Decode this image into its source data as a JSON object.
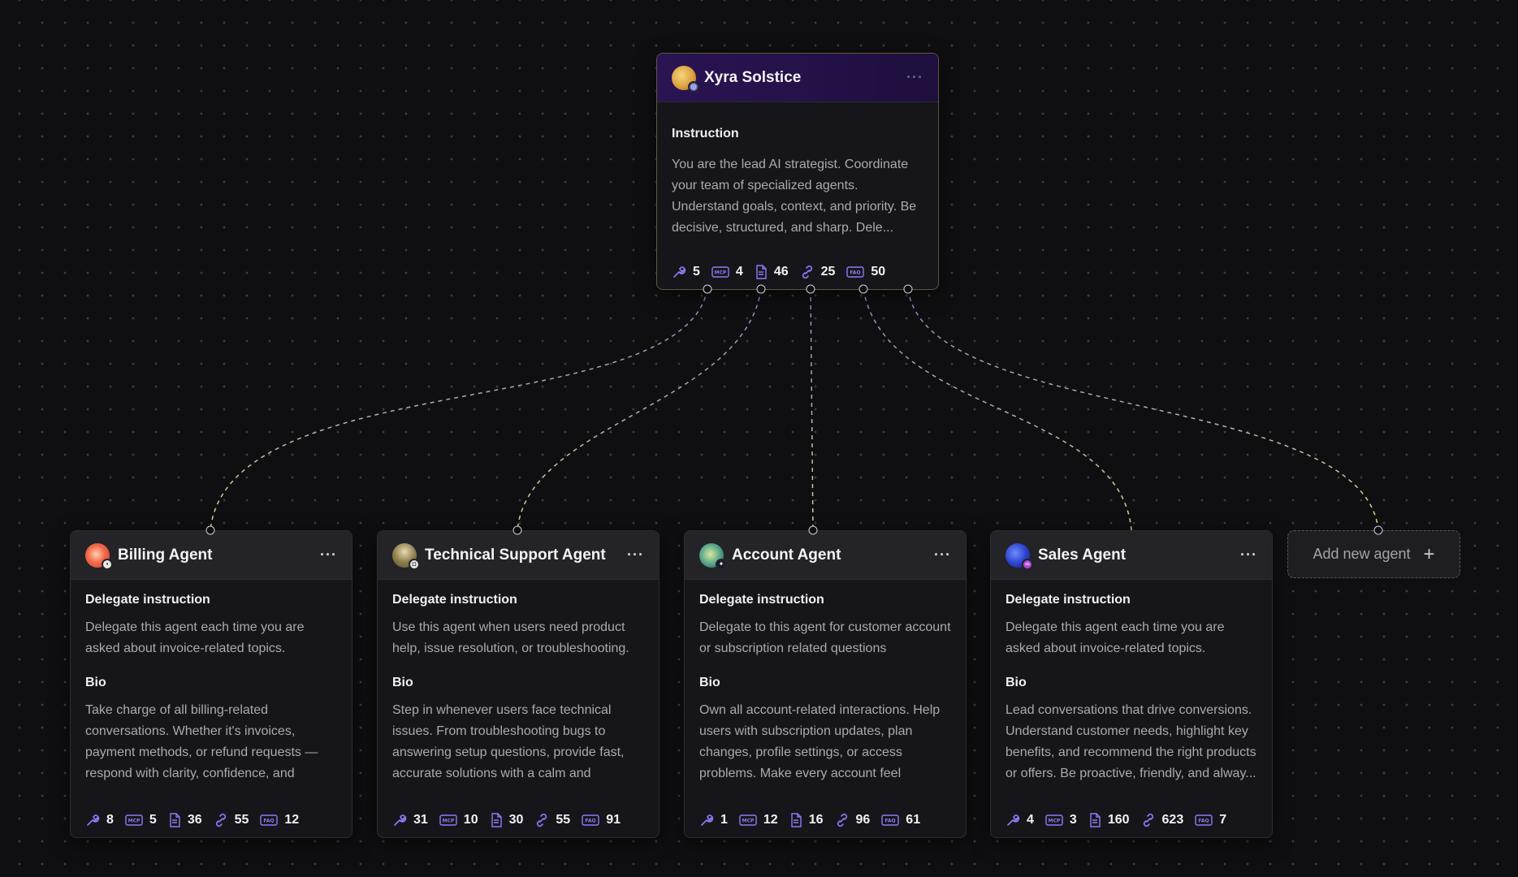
{
  "lead": {
    "name": "Xyra Solstice",
    "menu": "···",
    "section_title": "Instruction",
    "instruction": "You are the lead AI strategist. Coordinate your team of specialized agents. Understand goals, context, and priority. Be decisive, structured, and sharp. Dele...",
    "stats": {
      "tools": "5",
      "mcp": "4",
      "docs": "46",
      "links": "25",
      "faq": "50"
    }
  },
  "agents": [
    {
      "name": "Billing Agent",
      "menu": "···",
      "delegate_title": "Delegate instruction",
      "delegate": "Delegate this agent each time you are asked about invoice-related topics.",
      "bio_title": "Bio",
      "bio": "Take charge of all billing-related conversations. Whether it's invoices, payment methods, or refund requests — respond with clarity, confidence, and preci...",
      "stats": {
        "tools": "8",
        "mcp": "5",
        "docs": "36",
        "links": "55",
        "faq": "12"
      }
    },
    {
      "name": "Technical Support Agent",
      "menu": "···",
      "delegate_title": "Delegate instruction",
      "delegate": "Use this agent when users need product help, issue resolution, or troubleshooting. I...",
      "bio_title": "Bio",
      "bio": "Step in whenever users face technical issues. From troubleshooting bugs to answering setup questions, provide fast, accurate solutions with a calm and reassu...",
      "stats": {
        "tools": "31",
        "mcp": "10",
        "docs": "30",
        "links": "55",
        "faq": "91"
      }
    },
    {
      "name": "Account Agent",
      "menu": "···",
      "delegate_title": "Delegate instruction",
      "delegate": "Delegate to this agent for customer account or subscription related questions",
      "bio_title": "Bio",
      "bio": "Own all account-related interactions. Help users with subscription updates, plan changes, profile settings, or access problems. Make every account feel manag...",
      "stats": {
        "tools": "1",
        "mcp": "12",
        "docs": "16",
        "links": "96",
        "faq": "61"
      }
    },
    {
      "name": "Sales Agent",
      "menu": "···",
      "delegate_title": "Delegate instruction",
      "delegate": "Delegate this agent each time you are asked about invoice-related topics.",
      "bio_title": "Bio",
      "bio": "Lead conversations that drive conversions. Understand customer needs, highlight key benefits, and recommend the right products or offers. Be proactive, friendly, and alway...",
      "stats": {
        "tools": "4",
        "mcp": "3",
        "docs": "160",
        "links": "623",
        "faq": "7"
      }
    }
  ],
  "add_agent": {
    "label": "Add new agent",
    "icon": "plus-icon"
  },
  "colors": {
    "accent_icon": "#8b7cf6",
    "edge_start": "#8c86c9",
    "edge_end": "#d8d68c",
    "lead_header": "#2a1453"
  },
  "icons": [
    "wrench-icon",
    "mcp-icon",
    "document-icon",
    "link-icon",
    "faq-icon"
  ]
}
